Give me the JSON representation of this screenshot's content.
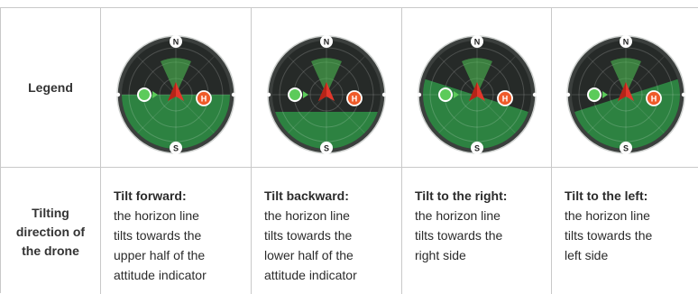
{
  "row_headers": {
    "legend": "Legend",
    "tilting": "Tilting\ndirection of\nthe drone"
  },
  "compass": {
    "north": "N",
    "south": "S",
    "home": "H"
  },
  "indicators": [
    {
      "tilt": "forward"
    },
    {
      "tilt": "backward"
    },
    {
      "tilt": "right"
    },
    {
      "tilt": "left"
    }
  ],
  "columns": [
    {
      "title": "Tilt forward:",
      "body": "the horizon line\ntilts towards the\nupper half of the\nattitude indicator"
    },
    {
      "title": "Tilt backward:",
      "body": "the horizon line\ntilts towards the\nlower half of the\nattitude indicator"
    },
    {
      "title": "Tilt to the right:",
      "body": "the horizon line\ntilts towards the\nright side"
    },
    {
      "title": "Tilt to the left:",
      "body": "the horizon line\ntilts towards the\nleft side"
    }
  ],
  "colors": {
    "dial_dark": "#262a28",
    "ground_green": "#2e8a43",
    "aircraft_red": "#e2372b",
    "home_orange": "#ef5b2a",
    "pilot_green": "#5ccb5a",
    "cone_green": "#4fc454"
  }
}
